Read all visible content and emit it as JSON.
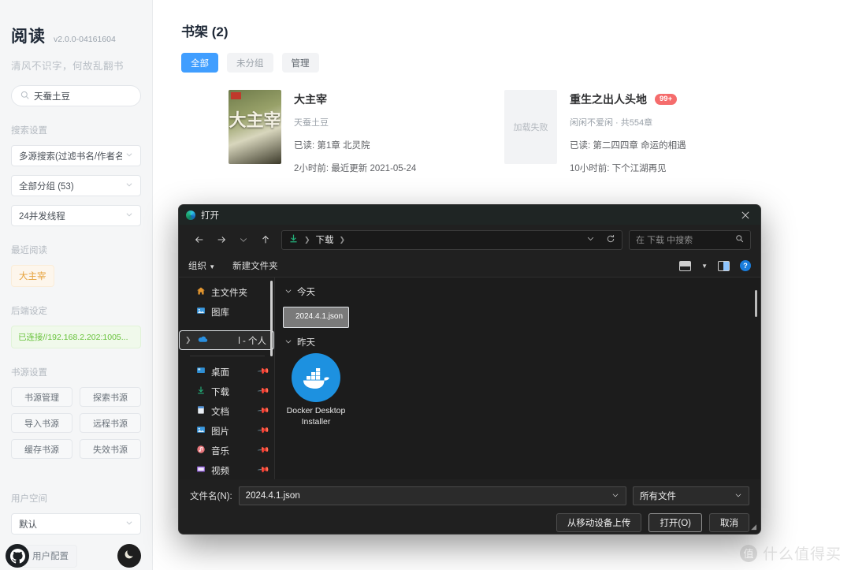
{
  "sidebar": {
    "app_title": "阅读",
    "version": "v2.0.0-04161604",
    "slogan": "清风不识字，何故乱翻书",
    "search": {
      "value": "天蚕土豆",
      "icon": "search-icon"
    },
    "search_settings_label": "搜索设置",
    "selects": [
      {
        "label": "多源搜索(过滤书名/作者名)"
      },
      {
        "label": "全部分组 (53)"
      },
      {
        "label": "24并发线程"
      }
    ],
    "recent_label": "最近阅读",
    "recent_items": [
      "大主宰"
    ],
    "backend_label": "后端设定",
    "backend_status": "已连接//192.168.2.202:1005...",
    "source_label": "书源设置",
    "source_buttons": [
      "书源管理",
      "探索书源",
      "导入书源",
      "远程书源",
      "缓存书源",
      "失效书源"
    ],
    "user_space_label": "用户空间",
    "user_space_value": "默认",
    "user_config_label": "用户配置",
    "github_icon": "github-icon",
    "theme_icon": "moon-icon"
  },
  "main": {
    "page_title": "书架 (2)",
    "tabs": [
      {
        "label": "全部",
        "state": "active"
      },
      {
        "label": "未分组",
        "state": "idle"
      },
      {
        "label": "管理",
        "state": "plain"
      }
    ],
    "books": [
      {
        "cover_text": "大主宰",
        "cover_state": "art",
        "title": "大主宰",
        "author": "天蚕土豆",
        "progress": "已读: 第1章 北灵院",
        "updated": "2小时前: 最近更新 2021-05-24",
        "badge": ""
      },
      {
        "cover_text": "加载失败",
        "cover_state": "fail",
        "title": "重生之出人头地",
        "author": "闲闲不爱闲 · 共554章",
        "progress": "已读: 第二四四章 命运的相遇",
        "updated": "10小时前: 下个江湖再见",
        "badge": "99+"
      }
    ]
  },
  "dialog": {
    "title": "打开",
    "title_icon": "edge-icon",
    "close_icon": "close-icon",
    "nav": {
      "back_icon": "arrow-left-icon",
      "forward_icon": "arrow-right-icon",
      "recent_icon": "chevron-down-icon",
      "up_icon": "arrow-up-icon"
    },
    "path": {
      "folder_icon": "download-icon",
      "crumbs": [
        "下载"
      ],
      "dropdown_icon": "chevron-down-icon",
      "refresh_icon": "refresh-icon"
    },
    "search_placeholder": "在 下载 中搜索",
    "search_icon": "search-icon",
    "commands": {
      "organize": "组织",
      "new_folder": "新建文件夹",
      "view_icon": "view-layout-icon",
      "view_chevron": "chevron-down-icon",
      "preview_icon": "preview-pane-icon",
      "help_icon": "help-icon"
    },
    "nav_items": [
      {
        "label": "主文件夹",
        "icon": "home-icon",
        "pinned": false,
        "selected": false,
        "expandable": false
      },
      {
        "label": "图库",
        "icon": "gallery-icon",
        "pinned": false,
        "selected": false,
        "expandable": false
      },
      {
        "label": "l - 个人",
        "icon": "onedrive-icon",
        "pinned": false,
        "selected": true,
        "expandable": true
      },
      {
        "label": "桌面",
        "icon": "desktop-icon",
        "pinned": true,
        "selected": false,
        "expandable": false
      },
      {
        "label": "下载",
        "icon": "download-icon",
        "pinned": true,
        "selected": false,
        "expandable": false
      },
      {
        "label": "文档",
        "icon": "documents-icon",
        "pinned": true,
        "selected": false,
        "expandable": false
      },
      {
        "label": "图片",
        "icon": "pictures-icon",
        "pinned": true,
        "selected": false,
        "expandable": false
      },
      {
        "label": "音乐",
        "icon": "music-icon",
        "pinned": true,
        "selected": false,
        "expandable": false
      },
      {
        "label": "视频",
        "icon": "videos-icon",
        "pinned": true,
        "selected": false,
        "expandable": false
      }
    ],
    "groups": [
      {
        "label": "今天",
        "files": [
          {
            "name": "2024.4.1.json",
            "kind": "json-file-icon",
            "selected": true
          }
        ]
      },
      {
        "label": "昨天",
        "files": [
          {
            "name": "Docker Desktop Installer",
            "kind": "docker-icon",
            "selected": false
          }
        ]
      }
    ],
    "footer": {
      "filename_label": "文件名(N):",
      "filename_value": "2024.4.1.json",
      "filetype_value": "所有文件",
      "upload_button": "从移动设备上传",
      "open_button": "打开(O)",
      "cancel_button": "取消"
    }
  },
  "watermark": {
    "mark": "值",
    "text": "什么值得买"
  }
}
